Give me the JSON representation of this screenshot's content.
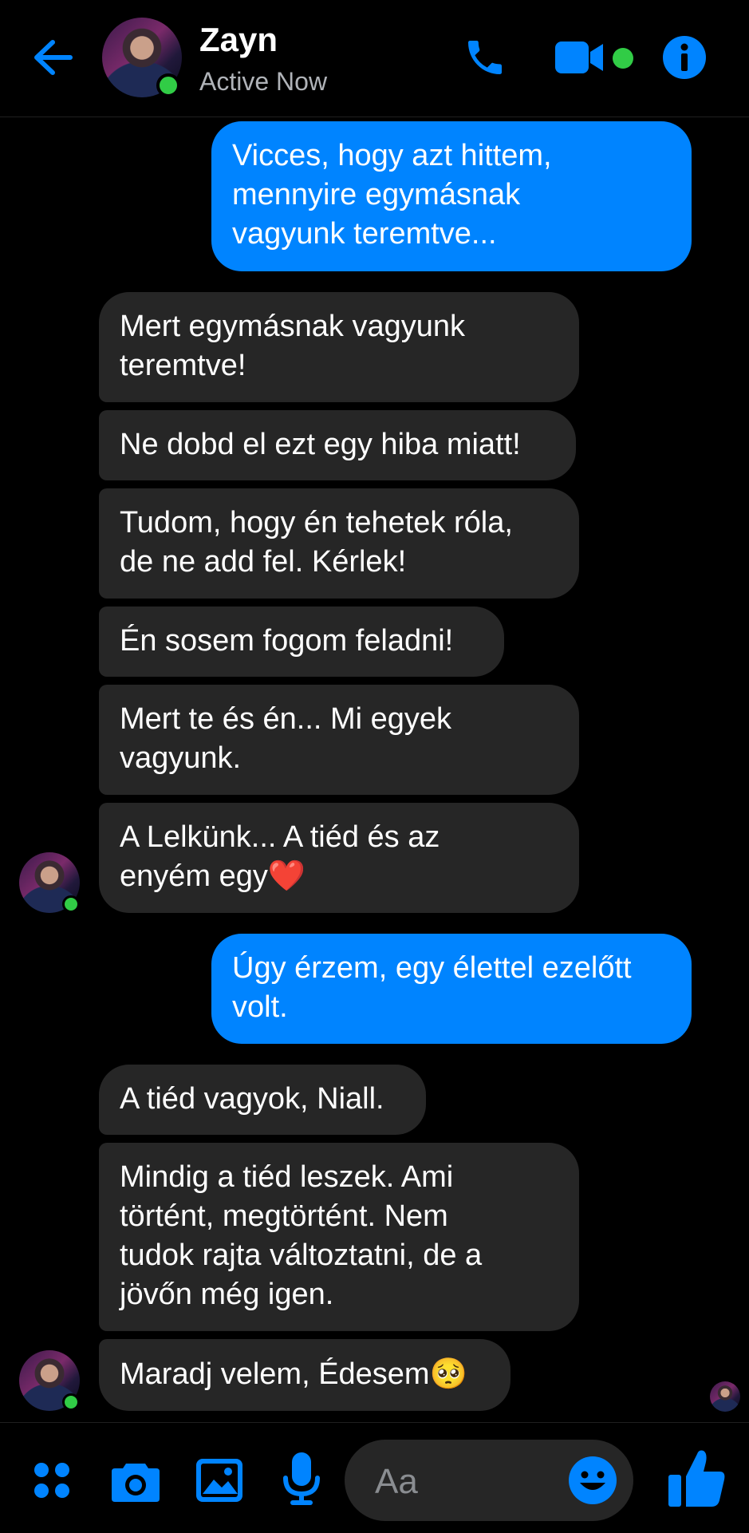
{
  "header": {
    "contact_name": "Zayn",
    "status": "Active Now"
  },
  "messages": [
    {
      "side": "out",
      "text": "Vicces, hogy azt hittem,\nmennyire egymásnak\nvagyunk teremtve..."
    },
    {
      "side": "in",
      "text": "Mert egymásnak vagyunk\nteremtve!"
    },
    {
      "side": "in",
      "text": "Ne dobd el ezt egy hiba miatt!"
    },
    {
      "side": "in",
      "text": "Tudom, hogy én tehetek róla,\nde ne add fel. Kérlek!"
    },
    {
      "side": "in",
      "text": "Én sosem fogom feladni!"
    },
    {
      "side": "in",
      "text": "Mert te és én... Mi egyek\nvagyunk."
    },
    {
      "side": "in",
      "text": "A Lelkünk... A tiéd és az\nenyém egy❤️"
    },
    {
      "side": "out",
      "text": "Úgy érzem, egy élettel ezelőtt\nvolt."
    },
    {
      "side": "in",
      "text": "A tiéd vagyok, Niall."
    },
    {
      "side": "in",
      "text": "Mindig a tiéd leszek. Ami\ntörtént, megtörtént. Nem\ntudok rajta változtatni, de a\njövőn még igen."
    },
    {
      "side": "in",
      "text": "Maradj velem, Édesem🥺"
    }
  ],
  "composer": {
    "placeholder": "Aa"
  },
  "colors": {
    "accent": "#0084ff",
    "incoming_bubble": "#262626",
    "online": "#31cc46",
    "background": "#000000"
  },
  "icons": [
    "back-arrow-icon",
    "phone-icon",
    "video-camera-icon",
    "info-icon",
    "apps-menu-icon",
    "camera-icon",
    "gallery-icon",
    "microphone-icon",
    "emoji-icon",
    "like-thumb-icon"
  ]
}
